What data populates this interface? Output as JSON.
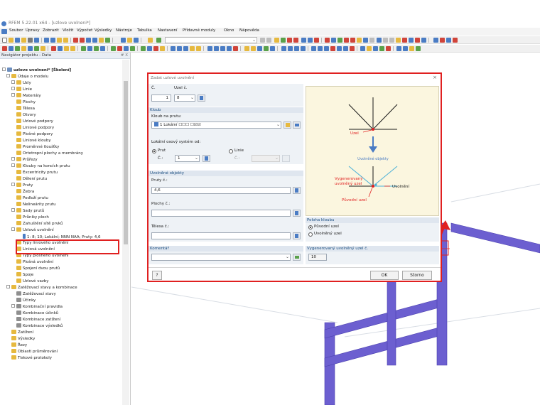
{
  "window": {
    "title": "RFEM 5.22.01 x64 - [uzlove uvolneni*]"
  },
  "menu": [
    "Soubor",
    "Úpravy",
    "Zobrazit",
    "Vložit",
    "Výpočet",
    "Výsledky",
    "Nástroje",
    "Tabulka",
    "Nastavení",
    "Přídavné moduly",
    "Okno",
    "Nápověda"
  ],
  "navigator": {
    "title": "Navigátor projektu - Data",
    "pin_controls": "# X",
    "items": [
      "uzlove uvolneni* [Školení]",
      "Údaje o modelu",
      "Uzly",
      "Linie",
      "Materiály",
      "Plochy",
      "Tělesa",
      "Otvory",
      "Uzlové podpory",
      "Liniové podpory",
      "Plošné podpory",
      "Liniové klouby",
      "Proměnné tloušťky",
      "Ortotropní plochy a membrány",
      "Průřezy",
      "Klouby na koncích prutu",
      "Excentricity prutu",
      "Dělení prutu",
      "Pruty",
      "Žebra",
      "Podloží prutu",
      "Nelineárity prutu",
      "Sady prutů",
      "Průniky ploch",
      "Zahuštění sítě prvků",
      "Uzlová uvolnění",
      "1: 8; 10; Lokální; NNN NAA; Pruty: 4,6",
      "Typy liniového uvolnění",
      "Liniová uvolnění",
      "Typy plošného uvolnění",
      "Plošná uvolnění",
      "Spojení dvou prutů",
      "Spoje",
      "Uzlové vazby",
      "Zatěžovací stavy a kombinace",
      "Zatěžovací stavy",
      "Účinky",
      "Kombinační pravidla",
      "Kombinace účinků",
      "Kombinace zatížení",
      "Kombinace výsledků",
      "Zatížení",
      "Výsledky",
      "Řezy",
      "Oblasti průměrování",
      "Tiskové protokoly"
    ]
  },
  "dialog": {
    "title": "Zadat uzlové uvolnění",
    "close": "×",
    "no_label": "Č.",
    "no_value": "1",
    "node_label": "Uzel č.",
    "node_value": "8",
    "hinge_section": "Kloub",
    "hinge_on_member_label": "Kloub na prutu:",
    "hinge_value": "1  Lokální  ☐☐☐  ☐☑☑",
    "local_axis_label": "Lokální osový systém od:",
    "radio_member": "Prut",
    "radio_line": "Linie",
    "member_no_label": "Č.:",
    "member_no_value": "1",
    "line_no_label": "Č.:",
    "released_section": "Uvolněné objekty",
    "members_label": "Pruty č.:",
    "members_value": "4,6",
    "surfaces_label": "Plochy č.:",
    "surfaces_value": "",
    "solids_label": "Tělesa č.:",
    "solids_value": "",
    "position_section": "Poloha kloubu",
    "radio_original": "Původní uzel",
    "radio_released": "Uvolněný uzel",
    "comment_section": "Komentář",
    "comment_value": "",
    "generated_section": "Vygenerovaný uvolněný uzel č.",
    "generated_value": "10",
    "help": "?",
    "ok": "OK",
    "cancel": "Storno",
    "preview": {
      "node_label": "Uzel",
      "released_objects_label": "Uvolněné objekty",
      "generated_label_1": "Vygenerovaný",
      "generated_label_2": "uvolněný uzel",
      "release_label": "Uvolnění",
      "original_node_label": "Původní uzel"
    }
  },
  "colors": {
    "highlight": "#e02020",
    "accent": "#4a7cc4",
    "preview_bg": "#fbf6df",
    "members": "#6c5fd0"
  }
}
